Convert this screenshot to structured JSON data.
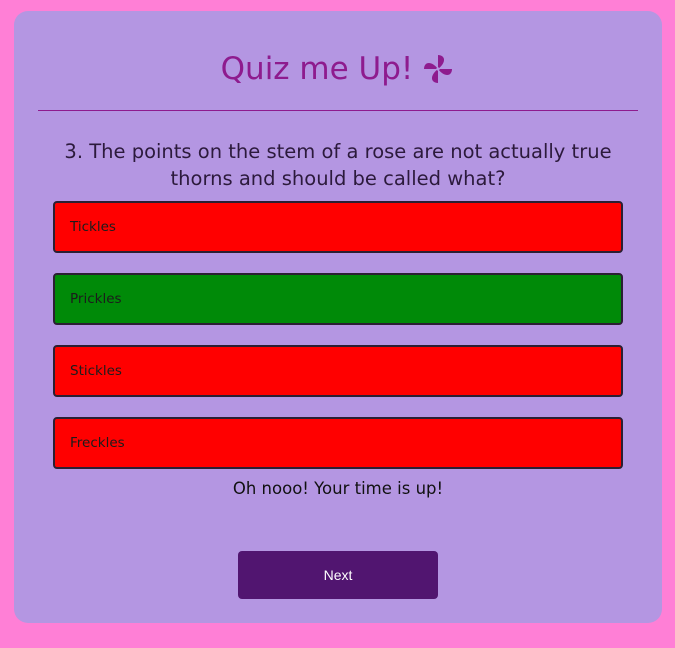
{
  "header": {
    "title": "Quiz me Up!",
    "icon": "pinwheel-icon",
    "title_color": "#8e1b8e"
  },
  "question": {
    "text": "3. The points on the stem of a rose are not actually true thorns and should be called what?"
  },
  "answers": [
    {
      "label": "Tickles",
      "state": "incorrect",
      "color": "#ff0000"
    },
    {
      "label": "Prickles",
      "state": "correct",
      "color": "#008a08"
    },
    {
      "label": "Stickles",
      "state": "incorrect",
      "color": "#ff0000"
    },
    {
      "label": "Freckles",
      "state": "incorrect",
      "color": "#ff0000"
    }
  ],
  "feedback": {
    "message": "Oh nooo! Your time is up!"
  },
  "next_button": {
    "label": "Next",
    "color": "#511570"
  },
  "colors": {
    "page_background": "#ff7fd6",
    "card_background": "#b496e2"
  }
}
